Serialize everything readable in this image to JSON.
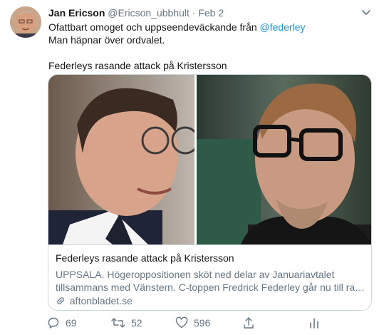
{
  "tweet": {
    "author_name": "Jan Ericson",
    "author_handle": "@Ericson_ubbhult",
    "separator": "·",
    "date": "Feb 2",
    "text_line1_prefix": "Ofattbart omoget och uppseendeväckande från ",
    "mention": "@federley",
    "text_line2": "Man häpnar över ordvalet.",
    "text_line3": "Federleys rasande attack på Kristersson"
  },
  "card": {
    "title": "Federleys rasande attack på Kristersson",
    "desc_line1": "UPPSALA. Högeroppositionen sköt ned delar av Januariavtalet",
    "desc_line2": "tillsammans med Vänstern. C-toppen Fredrick Federley går nu till rasand…",
    "domain": "aftonbladet.se"
  },
  "actions": {
    "replies": "69",
    "retweets": "52",
    "likes": "596"
  },
  "colors": {
    "link": "#1b95e0",
    "secondary_text": "#657786",
    "border": "#ccd6dd"
  },
  "icons": [
    "chevron-down-icon",
    "link-icon",
    "reply-icon",
    "retweet-icon",
    "like-icon",
    "share-icon",
    "analytics-icon"
  ]
}
